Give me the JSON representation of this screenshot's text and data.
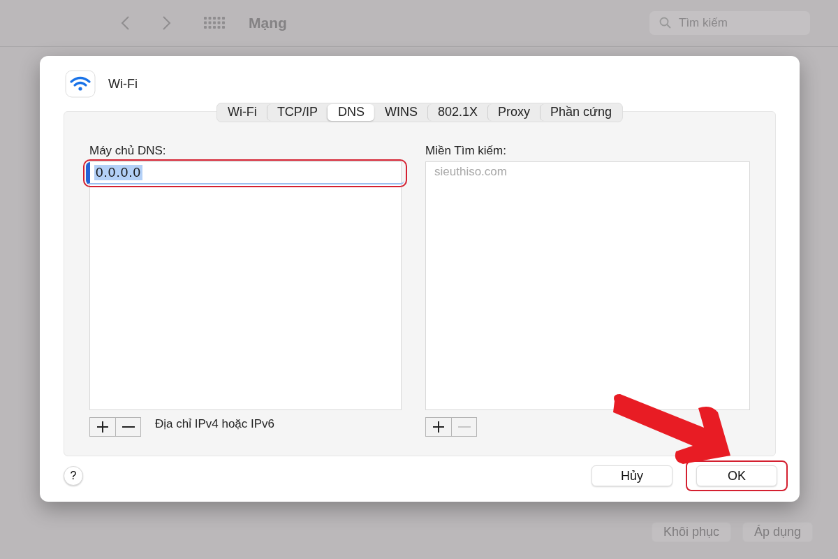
{
  "window": {
    "title": "Mạng",
    "search": {
      "placeholder": "Tìm kiếm"
    },
    "buttons": [
      {
        "label": "Khôi phục",
        "disabled": true
      },
      {
        "label": "Áp dụng",
        "disabled": true
      }
    ]
  },
  "sheet": {
    "title": "Wi-Fi",
    "tabs": [
      {
        "label": "Wi-Fi",
        "selected": false
      },
      {
        "label": "TCP/IP",
        "selected": false
      },
      {
        "label": "DNS",
        "selected": true
      },
      {
        "label": "WINS",
        "selected": false
      },
      {
        "label": "802.1X",
        "selected": false
      },
      {
        "label": "Proxy",
        "selected": false
      },
      {
        "label": "Phần cứng",
        "selected": false
      }
    ],
    "dns_servers": {
      "label": "Máy chủ DNS:",
      "entries": [
        {
          "value": "0.0.0.0",
          "selected": true,
          "highlighted": true
        }
      ],
      "add_disabled": false,
      "remove_disabled": false,
      "hint": "Địa chỉ IPv4 hoặc IPv6"
    },
    "search_domains": {
      "label": "Miền Tìm kiếm:",
      "placeholder": "sieuthiso.com",
      "add_disabled": false,
      "remove_disabled": true
    },
    "help": "?",
    "buttons": [
      {
        "label": "Hủy",
        "highlighted": false
      },
      {
        "label": "OK",
        "highlighted": true
      }
    ]
  }
}
